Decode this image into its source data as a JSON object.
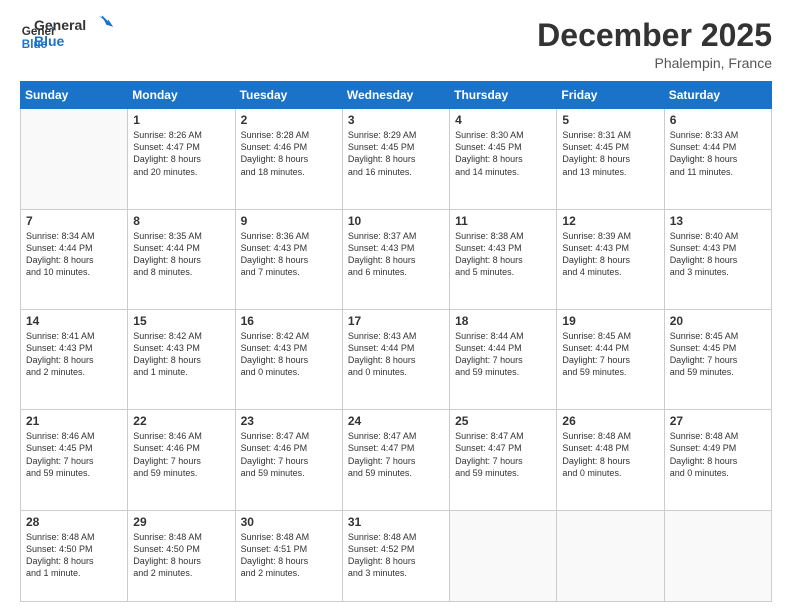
{
  "logo": {
    "line1": "General",
    "line2": "Blue"
  },
  "title": "December 2025",
  "location": "Phalempin, France",
  "days_header": [
    "Sunday",
    "Monday",
    "Tuesday",
    "Wednesday",
    "Thursday",
    "Friday",
    "Saturday"
  ],
  "weeks": [
    [
      {
        "day": "",
        "info": ""
      },
      {
        "day": "1",
        "info": "Sunrise: 8:26 AM\nSunset: 4:47 PM\nDaylight: 8 hours\nand 20 minutes."
      },
      {
        "day": "2",
        "info": "Sunrise: 8:28 AM\nSunset: 4:46 PM\nDaylight: 8 hours\nand 18 minutes."
      },
      {
        "day": "3",
        "info": "Sunrise: 8:29 AM\nSunset: 4:45 PM\nDaylight: 8 hours\nand 16 minutes."
      },
      {
        "day": "4",
        "info": "Sunrise: 8:30 AM\nSunset: 4:45 PM\nDaylight: 8 hours\nand 14 minutes."
      },
      {
        "day": "5",
        "info": "Sunrise: 8:31 AM\nSunset: 4:45 PM\nDaylight: 8 hours\nand 13 minutes."
      },
      {
        "day": "6",
        "info": "Sunrise: 8:33 AM\nSunset: 4:44 PM\nDaylight: 8 hours\nand 11 minutes."
      }
    ],
    [
      {
        "day": "7",
        "info": "Sunrise: 8:34 AM\nSunset: 4:44 PM\nDaylight: 8 hours\nand 10 minutes."
      },
      {
        "day": "8",
        "info": "Sunrise: 8:35 AM\nSunset: 4:44 PM\nDaylight: 8 hours\nand 8 minutes."
      },
      {
        "day": "9",
        "info": "Sunrise: 8:36 AM\nSunset: 4:43 PM\nDaylight: 8 hours\nand 7 minutes."
      },
      {
        "day": "10",
        "info": "Sunrise: 8:37 AM\nSunset: 4:43 PM\nDaylight: 8 hours\nand 6 minutes."
      },
      {
        "day": "11",
        "info": "Sunrise: 8:38 AM\nSunset: 4:43 PM\nDaylight: 8 hours\nand 5 minutes."
      },
      {
        "day": "12",
        "info": "Sunrise: 8:39 AM\nSunset: 4:43 PM\nDaylight: 8 hours\nand 4 minutes."
      },
      {
        "day": "13",
        "info": "Sunrise: 8:40 AM\nSunset: 4:43 PM\nDaylight: 8 hours\nand 3 minutes."
      }
    ],
    [
      {
        "day": "14",
        "info": "Sunrise: 8:41 AM\nSunset: 4:43 PM\nDaylight: 8 hours\nand 2 minutes."
      },
      {
        "day": "15",
        "info": "Sunrise: 8:42 AM\nSunset: 4:43 PM\nDaylight: 8 hours\nand 1 minute."
      },
      {
        "day": "16",
        "info": "Sunrise: 8:42 AM\nSunset: 4:43 PM\nDaylight: 8 hours\nand 0 minutes."
      },
      {
        "day": "17",
        "info": "Sunrise: 8:43 AM\nSunset: 4:44 PM\nDaylight: 8 hours\nand 0 minutes."
      },
      {
        "day": "18",
        "info": "Sunrise: 8:44 AM\nSunset: 4:44 PM\nDaylight: 7 hours\nand 59 minutes."
      },
      {
        "day": "19",
        "info": "Sunrise: 8:45 AM\nSunset: 4:44 PM\nDaylight: 7 hours\nand 59 minutes."
      },
      {
        "day": "20",
        "info": "Sunrise: 8:45 AM\nSunset: 4:45 PM\nDaylight: 7 hours\nand 59 minutes."
      }
    ],
    [
      {
        "day": "21",
        "info": "Sunrise: 8:46 AM\nSunset: 4:45 PM\nDaylight: 7 hours\nand 59 minutes."
      },
      {
        "day": "22",
        "info": "Sunrise: 8:46 AM\nSunset: 4:46 PM\nDaylight: 7 hours\nand 59 minutes."
      },
      {
        "day": "23",
        "info": "Sunrise: 8:47 AM\nSunset: 4:46 PM\nDaylight: 7 hours\nand 59 minutes."
      },
      {
        "day": "24",
        "info": "Sunrise: 8:47 AM\nSunset: 4:47 PM\nDaylight: 7 hours\nand 59 minutes."
      },
      {
        "day": "25",
        "info": "Sunrise: 8:47 AM\nSunset: 4:47 PM\nDaylight: 7 hours\nand 59 minutes."
      },
      {
        "day": "26",
        "info": "Sunrise: 8:48 AM\nSunset: 4:48 PM\nDaylight: 8 hours\nand 0 minutes."
      },
      {
        "day": "27",
        "info": "Sunrise: 8:48 AM\nSunset: 4:49 PM\nDaylight: 8 hours\nand 0 minutes."
      }
    ],
    [
      {
        "day": "28",
        "info": "Sunrise: 8:48 AM\nSunset: 4:50 PM\nDaylight: 8 hours\nand 1 minute."
      },
      {
        "day": "29",
        "info": "Sunrise: 8:48 AM\nSunset: 4:50 PM\nDaylight: 8 hours\nand 2 minutes."
      },
      {
        "day": "30",
        "info": "Sunrise: 8:48 AM\nSunset: 4:51 PM\nDaylight: 8 hours\nand 2 minutes."
      },
      {
        "day": "31",
        "info": "Sunrise: 8:48 AM\nSunset: 4:52 PM\nDaylight: 8 hours\nand 3 minutes."
      },
      {
        "day": "",
        "info": ""
      },
      {
        "day": "",
        "info": ""
      },
      {
        "day": "",
        "info": ""
      }
    ]
  ]
}
